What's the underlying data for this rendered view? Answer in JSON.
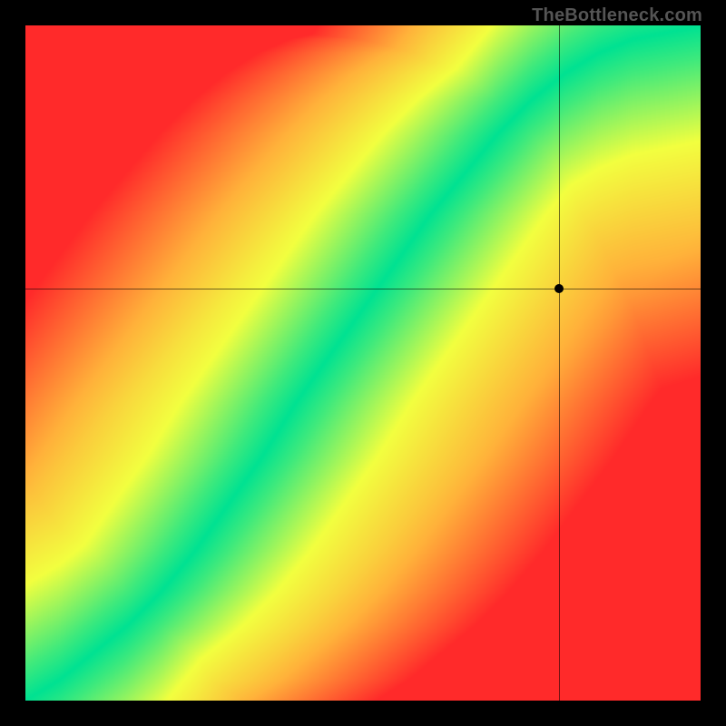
{
  "watermark": "TheBottleneck.com",
  "chart_data": {
    "type": "heatmap",
    "title": "",
    "xlabel": "",
    "ylabel": "",
    "xlim": [
      0,
      100
    ],
    "ylim": [
      0,
      100
    ],
    "description": "Compatibility heatmap. A narrow green band marks the balanced region (no bottleneck) along a roughly diagonal curve; away from the band the map grades through yellow and orange to red indicating severe bottleneck. Thin black crosshairs mark a queried point.",
    "ideal_curve_points": [
      [
        0,
        0
      ],
      [
        5,
        3
      ],
      [
        10,
        7
      ],
      [
        15,
        11
      ],
      [
        20,
        16
      ],
      [
        25,
        22
      ],
      [
        30,
        29
      ],
      [
        35,
        36
      ],
      [
        40,
        44
      ],
      [
        45,
        51
      ],
      [
        50,
        58
      ],
      [
        55,
        65
      ],
      [
        60,
        72
      ],
      [
        65,
        78
      ],
      [
        70,
        84
      ],
      [
        75,
        89
      ],
      [
        80,
        93
      ],
      [
        85,
        96
      ],
      [
        90,
        98
      ],
      [
        95,
        99
      ],
      [
        100,
        100
      ]
    ],
    "band_half_width_percent": 5.0,
    "color_stops": [
      {
        "t": 0.0,
        "color": "#00e292"
      },
      {
        "t": 0.3,
        "color": "#f2ff3f"
      },
      {
        "t": 0.6,
        "color": "#ffb23a"
      },
      {
        "t": 1.0,
        "color": "#ff2a2a"
      }
    ],
    "queried_point": {
      "x": 79,
      "y": 61
    }
  }
}
